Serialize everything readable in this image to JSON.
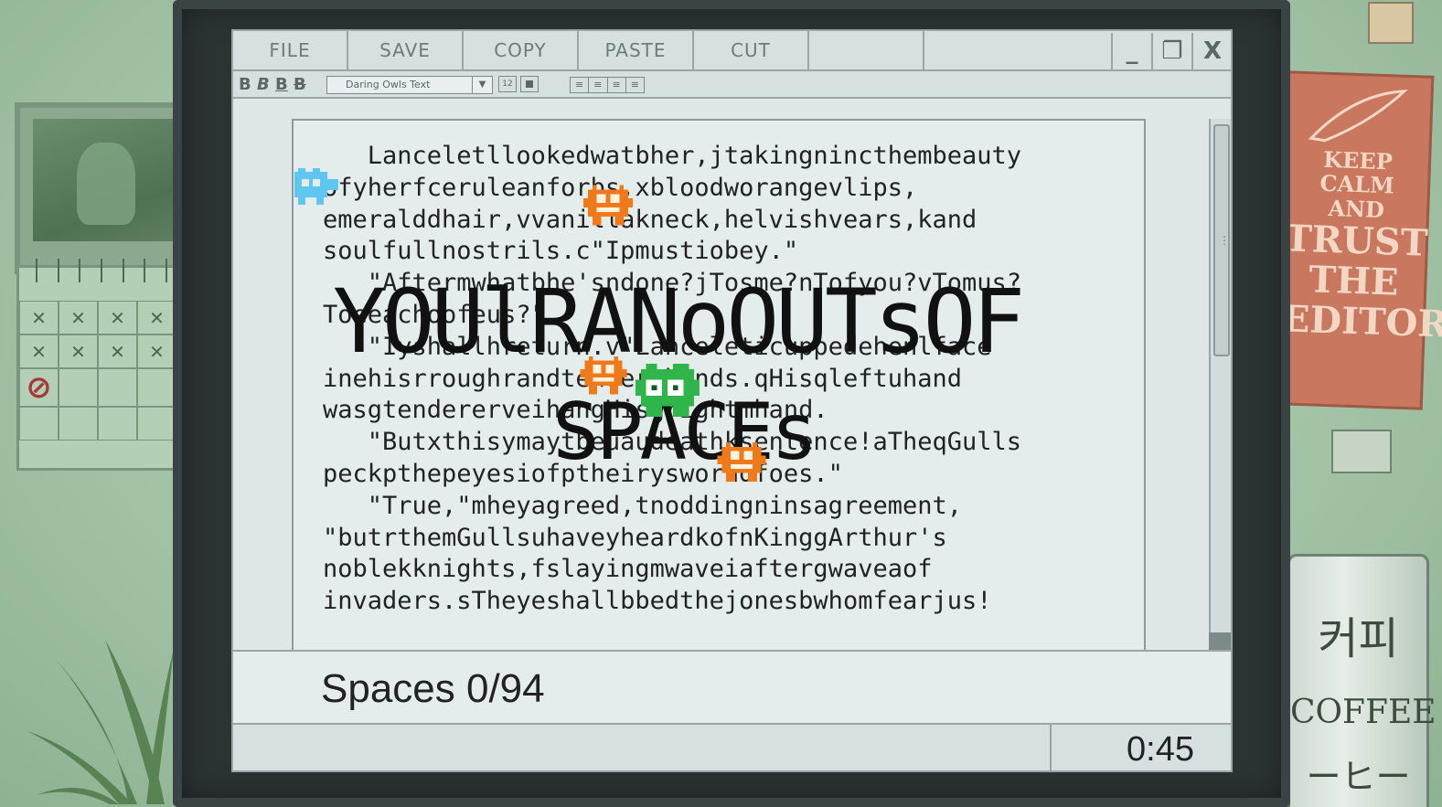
{
  "menu": {
    "file": "FILE",
    "save": "SAVE",
    "copy": "COPY",
    "paste": "PASTE",
    "cut": "CUT"
  },
  "window_controls": {
    "minimize": "_",
    "restore": "❐",
    "close": "X"
  },
  "format": {
    "bold": "B",
    "italic": "B",
    "underline": "B",
    "strike": "B",
    "font_name": "Daring Owls Text",
    "font_size": "12"
  },
  "document": {
    "lines": [
      "   Lanceletllookedwatbher,jtakingnincthembeauty",
      "ofyherfceruleanforbs,xbloodworangevlips,",
      "emeralddhair,vvanillakneck,helvishvears,kand",
      "soulfullnostrils.c\"Ipmustiobey.\"",
      "   \"Aftermwhatbhe'sndone?jTosme?nTofyou?vTomus?",
      "Toeeachoofeus?\"",
      "   \"Iyshallhreturn.v\"Lanceleticuppedehenlface",
      "inehisrroughrandtenderhhands.qHisqleftuhand",
      "wasgtendererveihangHisgrightmhand.",
      "   \"Butxthisymaytbeuaudeathksentence!aTheqGulls",
      "peckpthepeyesiofptheirysworndfoes.\"",
      "   \"True,\"mheyagreed,tnoddingninsagreement,",
      "\"butrthemGullsuhaveyheardkofnKinggArthur's",
      "noblekknights,fslayingmwaveiaftergwaveaof",
      "invaders.sTheyeshallbbedthejonesbwhomfearjus!"
    ]
  },
  "overlay": {
    "line1": "YOUlRANoOUTsOF",
    "line2": "SPACEs"
  },
  "status": {
    "spaces": "Spaces 0/94",
    "timer": "0:45"
  },
  "poster": {
    "line1": "KEEP",
    "line2": "CALM",
    "line3": "AND",
    "line4": "TRUST",
    "line5": "THE",
    "line6": "EDITOR!"
  },
  "mug": {
    "korean": "커피",
    "english": "COFFEE",
    "japanese": "ーヒー"
  },
  "colors": {
    "wall": "#a9c8ac",
    "bezel": "#2c3333",
    "screen": "#dfe7e7",
    "enemy_orange": "#f07a1a",
    "enemy_green": "#2fb54a",
    "player_blue": "#5fc6ef"
  }
}
